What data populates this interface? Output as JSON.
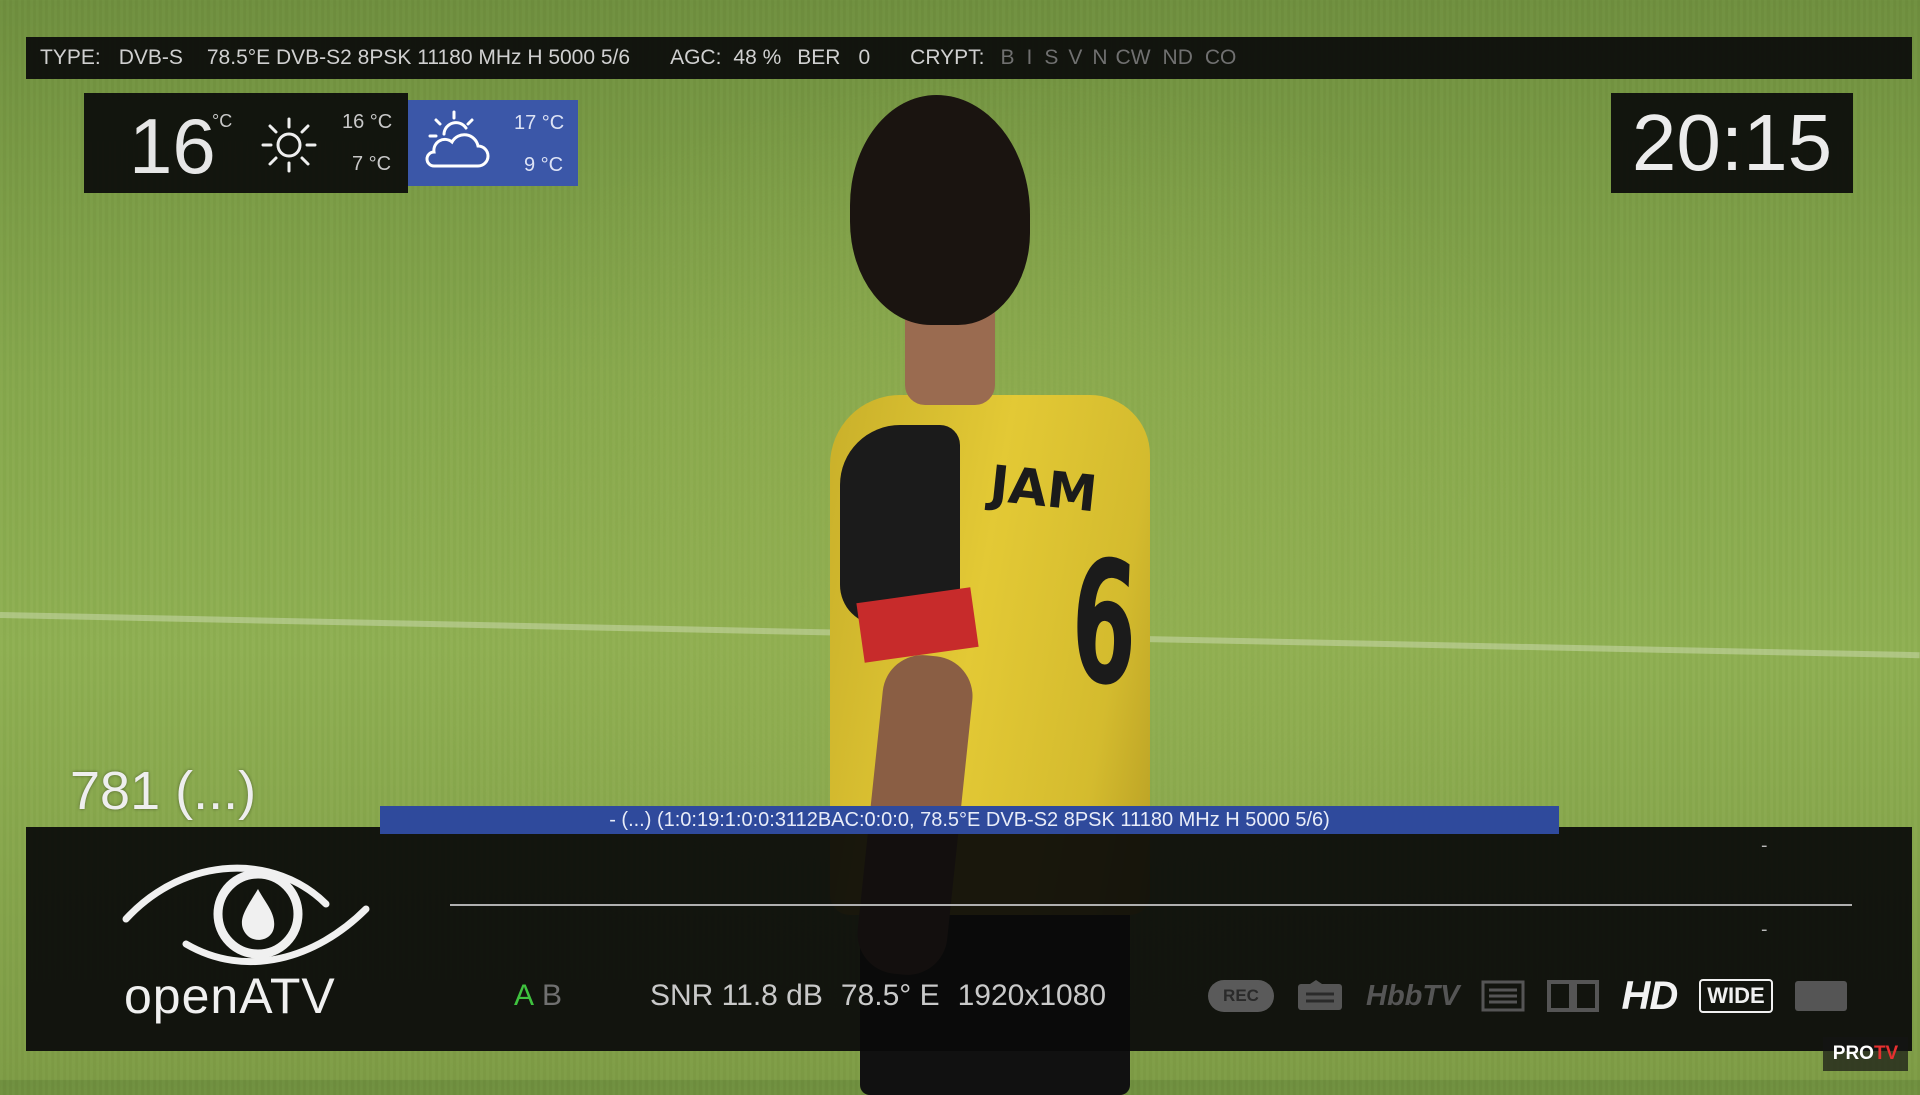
{
  "signal_bar": {
    "type_label": "TYPE:",
    "type_value": "DVB-S",
    "transponder": "78.5°E DVB-S2 8PSK 11180 MHz H 5000 5/6",
    "agc_label": "AGC:",
    "agc_value": "48 %",
    "ber_label": "BER",
    "ber_value": "0",
    "crypt_label": "CRYPT:",
    "crypt_systems": [
      "B",
      "I",
      "S",
      "V",
      "N",
      "CW",
      "ND",
      "CO"
    ]
  },
  "weather": {
    "current_temp": "16",
    "unit": "°C",
    "today_icon": "sun-icon",
    "today_high": "16 °C",
    "today_low": "7 °C",
    "tomorrow_icon": "cloud-sun-icon",
    "tomorrow_high": "17 °C",
    "tomorrow_low": "9 °C",
    "tomorrow_color": "#3b57a8"
  },
  "clock": {
    "time": "20:15"
  },
  "channel": {
    "number_text": "781 (...)"
  },
  "service": {
    "reference": "- (...) (1:0:19:1:0:0:3112BAC:0:0:0, 78.5°E DVB-S2 8PSK 11180 MHz H 5000 5/6)",
    "bar_color": "#2f4a9c"
  },
  "infobar": {
    "logo_text": "openATV",
    "logo_icon": "eye-logo-icon",
    "now_dash": "-",
    "next_dash": "-",
    "tuner_a": "A",
    "tuner_b": "B",
    "tuner_active_color": "#3fc23f",
    "snr": "SNR 11.8 dB",
    "orbital": "78.5° E",
    "resolution": "1920x1080",
    "indicators": {
      "rec": "REC",
      "subtitle_icon": "subtitle-icon",
      "hbbtv": "HbbTV",
      "teletext_icon": "teletext-icon",
      "dolby_icon": "dolby-icon",
      "hd": "HD",
      "wide": "WIDE",
      "crypt_icon": "crypt-icon"
    }
  },
  "watermark": {
    "pro": "PRO",
    "tv": "TV"
  },
  "video": {
    "shirt_name": "JAM",
    "shirt_number": "6"
  }
}
